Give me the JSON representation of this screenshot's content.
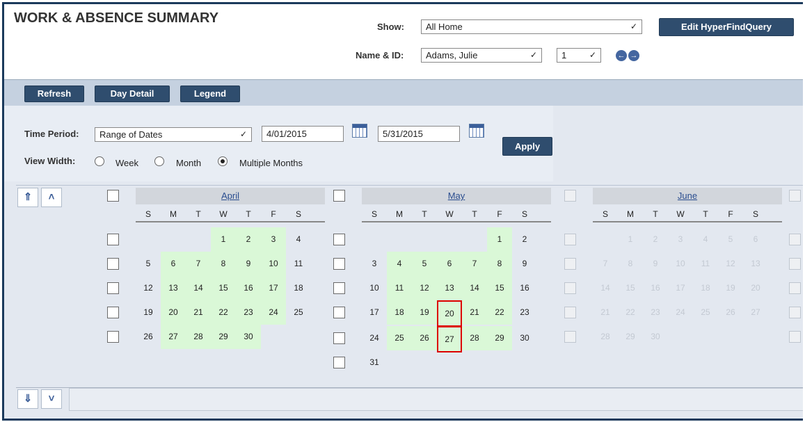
{
  "header": {
    "title": "WORK & ABSENCE SUMMARY",
    "show_label": "Show:",
    "show_value": "All Home",
    "name_label": "Name & ID:",
    "name_value": "Adams, Julie",
    "id_value": "1",
    "edit_button": "Edit HyperFindQuery"
  },
  "toolbar": {
    "refresh": "Refresh",
    "day_detail": "Day Detail",
    "legend": "Legend"
  },
  "time_period": {
    "label": "Time Period:",
    "value": "Range of Dates",
    "start_date": "4/01/2015",
    "end_date": "5/31/2015",
    "apply": "Apply"
  },
  "view_width": {
    "label": "View Width:",
    "options": [
      "Week",
      "Month",
      "Multiple Months"
    ],
    "selected": "Multiple Months"
  },
  "weekday_labels": [
    "S",
    "M",
    "T",
    "W",
    "T",
    "F",
    "S"
  ],
  "months": [
    {
      "name": "April",
      "weeks": [
        [
          "",
          "",
          "",
          "1",
          "2",
          "3",
          "4"
        ],
        [
          "5",
          "6",
          "7",
          "8",
          "9",
          "10",
          "11"
        ],
        [
          "12",
          "13",
          "14",
          "15",
          "16",
          "17",
          "18"
        ],
        [
          "19",
          "20",
          "21",
          "22",
          "23",
          "24",
          "25"
        ],
        [
          "26",
          "27",
          "28",
          "29",
          "30",
          "",
          ""
        ]
      ],
      "enabled": true
    },
    {
      "name": "May",
      "weeks": [
        [
          "",
          "",
          "",
          "",
          "",
          "1",
          "2"
        ],
        [
          "3",
          "4",
          "5",
          "6",
          "7",
          "8",
          "9"
        ],
        [
          "10",
          "11",
          "12",
          "13",
          "14",
          "15",
          "16"
        ],
        [
          "17",
          "18",
          "19",
          "20",
          "21",
          "22",
          "23"
        ],
        [
          "24",
          "25",
          "26",
          "27",
          "28",
          "29",
          "30"
        ],
        [
          "31",
          "",
          "",
          "",
          "",
          "",
          ""
        ]
      ],
      "selected_days": [
        "20",
        "27"
      ],
      "enabled": true
    },
    {
      "name": "June",
      "weeks": [
        [
          "",
          "1",
          "2",
          "3",
          "4",
          "5",
          "6"
        ],
        [
          "7",
          "8",
          "9",
          "10",
          "11",
          "12",
          "13"
        ],
        [
          "14",
          "15",
          "16",
          "17",
          "18",
          "19",
          "20"
        ],
        [
          "21",
          "22",
          "23",
          "24",
          "25",
          "26",
          "27"
        ],
        [
          "28",
          "29",
          "30",
          "",
          "",
          "",
          ""
        ]
      ],
      "enabled": false
    }
  ],
  "colors": {
    "frame": "#1b3a5c",
    "button": "#2f4d6e",
    "range_highlight": "#daf8d7",
    "selected_border": "#dd0000",
    "month_link": "#2a4d8f"
  }
}
